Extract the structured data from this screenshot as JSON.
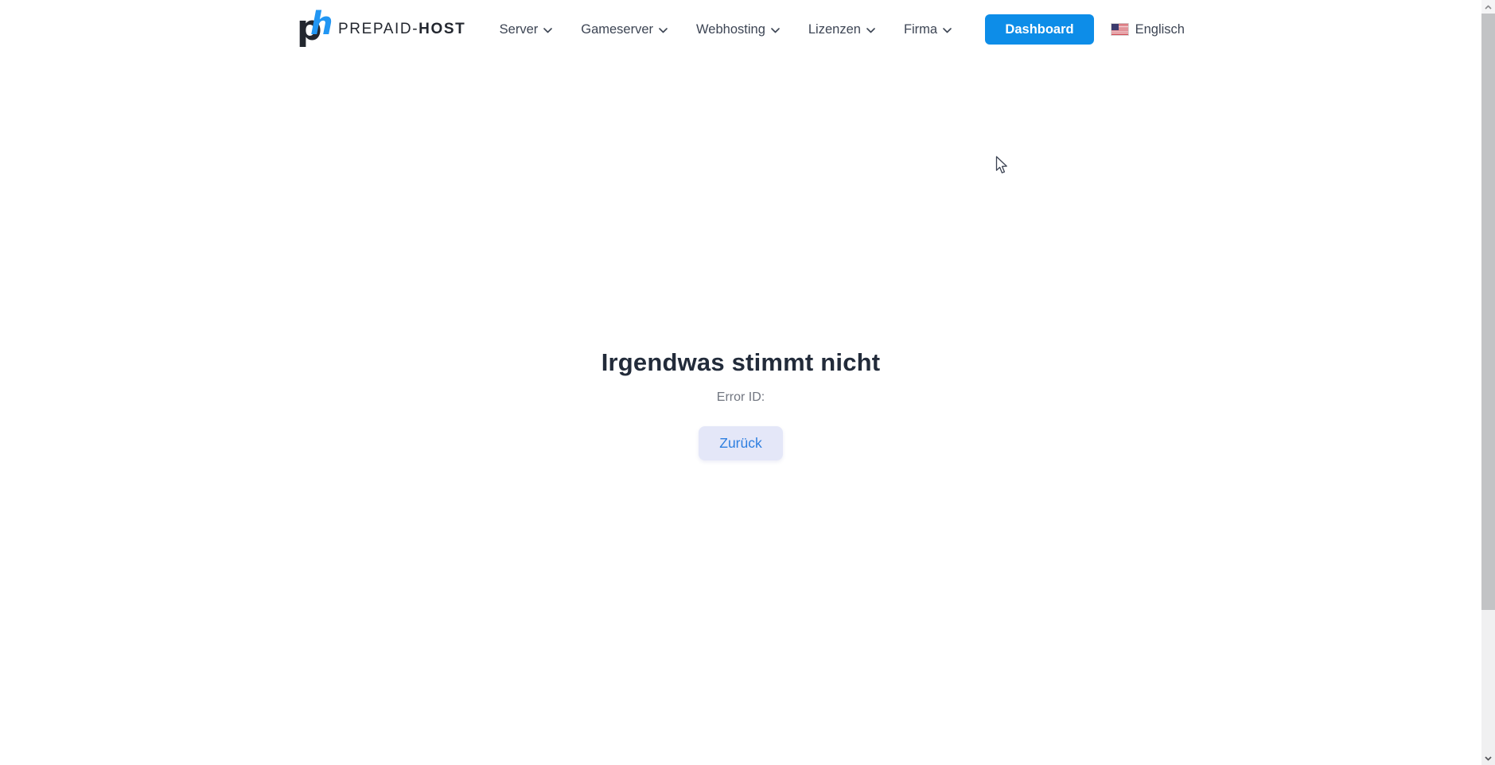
{
  "brand": {
    "logo_p": "p",
    "logo_h": "h",
    "name_regular": "PREPAID-",
    "name_bold": "HOST"
  },
  "nav": {
    "items": [
      {
        "label": "Server"
      },
      {
        "label": "Gameserver"
      },
      {
        "label": "Webhosting"
      },
      {
        "label": "Lizenzen"
      },
      {
        "label": "Firma"
      }
    ]
  },
  "header_actions": {
    "dashboard_label": "Dashboard",
    "language_label": "Englisch",
    "language_flag": "us-flag-icon"
  },
  "error_page": {
    "title": "Irgendwas stimmt nicht",
    "error_id_label": "Error ID:",
    "back_button_label": "Zurück"
  },
  "colors": {
    "accent_blue": "#0d8de8",
    "logo_blue": "#2196f3",
    "back_button_bg": "#e4e7f8",
    "back_button_text": "#2e7fe0",
    "heading_text": "#222b3a",
    "nav_text": "#3d4554",
    "muted_text": "#717680",
    "scrollbar_thumb": "#c2c3c5",
    "scrollbar_track": "#f0f0f1"
  }
}
